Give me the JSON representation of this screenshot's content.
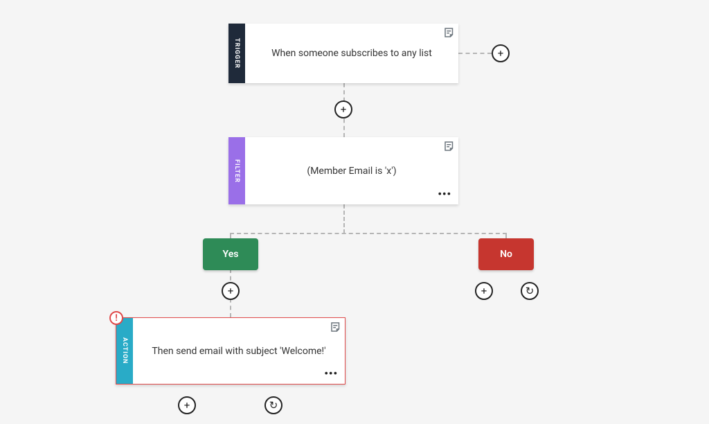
{
  "trigger": {
    "sidebar_label": "TRIGGER",
    "text": "When someone subscribes to any list"
  },
  "filter": {
    "sidebar_label": "FILTER",
    "text": "(Member Email is 'x')"
  },
  "branch": {
    "yes_label": "Yes",
    "no_label": "No"
  },
  "action": {
    "sidebar_label": "ACTION",
    "text": "Then send email with subject 'Welcome!'",
    "warning_glyph": "!"
  },
  "glyphs": {
    "plus": "+",
    "refresh": "↻",
    "more": "•••"
  }
}
